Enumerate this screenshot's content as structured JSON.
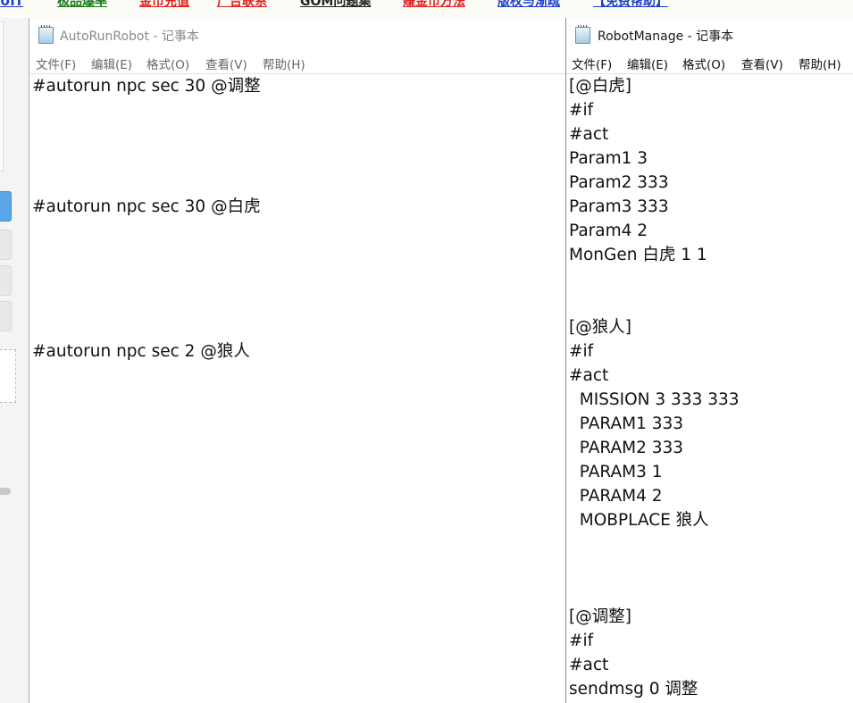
{
  "top_links": [
    {
      "text": "英UIT",
      "color": "#1e40c8"
    },
    {
      "text": "极品爆率",
      "color": "#1a7a1a"
    },
    {
      "text": "金币充值",
      "color": "#e02020"
    },
    {
      "text": "广告联系",
      "color": "#e02020"
    },
    {
      "text": "GOM问题集",
      "color": "#222222"
    },
    {
      "text": "赚金币方法",
      "color": "#e02020"
    },
    {
      "text": "版权与渐疏",
      "color": "#1e40c8"
    },
    {
      "text": "【免费帮助】",
      "color": "#1e40c8"
    }
  ],
  "window1": {
    "title": "AutoRunRobot - 记事本",
    "menu": [
      "文件(F)",
      "编辑(E)",
      "格式(O)",
      "查看(V)",
      "帮助(H)"
    ],
    "lines": [
      "#autorun npc sec 30 @调整",
      "",
      "",
      "",
      "",
      "#autorun npc sec 30 @白虎",
      "",
      "",
      "",
      "",
      "",
      "#autorun npc sec 2 @狼人"
    ]
  },
  "window2": {
    "title": "RobotManage - 记事本",
    "menu": [
      "文件(F)",
      "编辑(E)",
      "格式(O)",
      "查看(V)",
      "帮助(H)"
    ],
    "lines": [
      "[@白虎]",
      "#if",
      "#act",
      "Param1 3",
      "Param2 333",
      "Param3 333",
      "Param4 2",
      "MonGen 白虎 1 1",
      "",
      "",
      "[@狼人]",
      "#if",
      "#act",
      "  MISSION 3 333 333",
      "  PARAM1 333",
      "  PARAM2 333",
      "  PARAM3 1",
      "  PARAM4 2",
      "  MOBPLACE 狼人",
      "",
      "",
      "",
      "[@调整]",
      "#if",
      "#act",
      "sendmsg 0 调整"
    ]
  }
}
